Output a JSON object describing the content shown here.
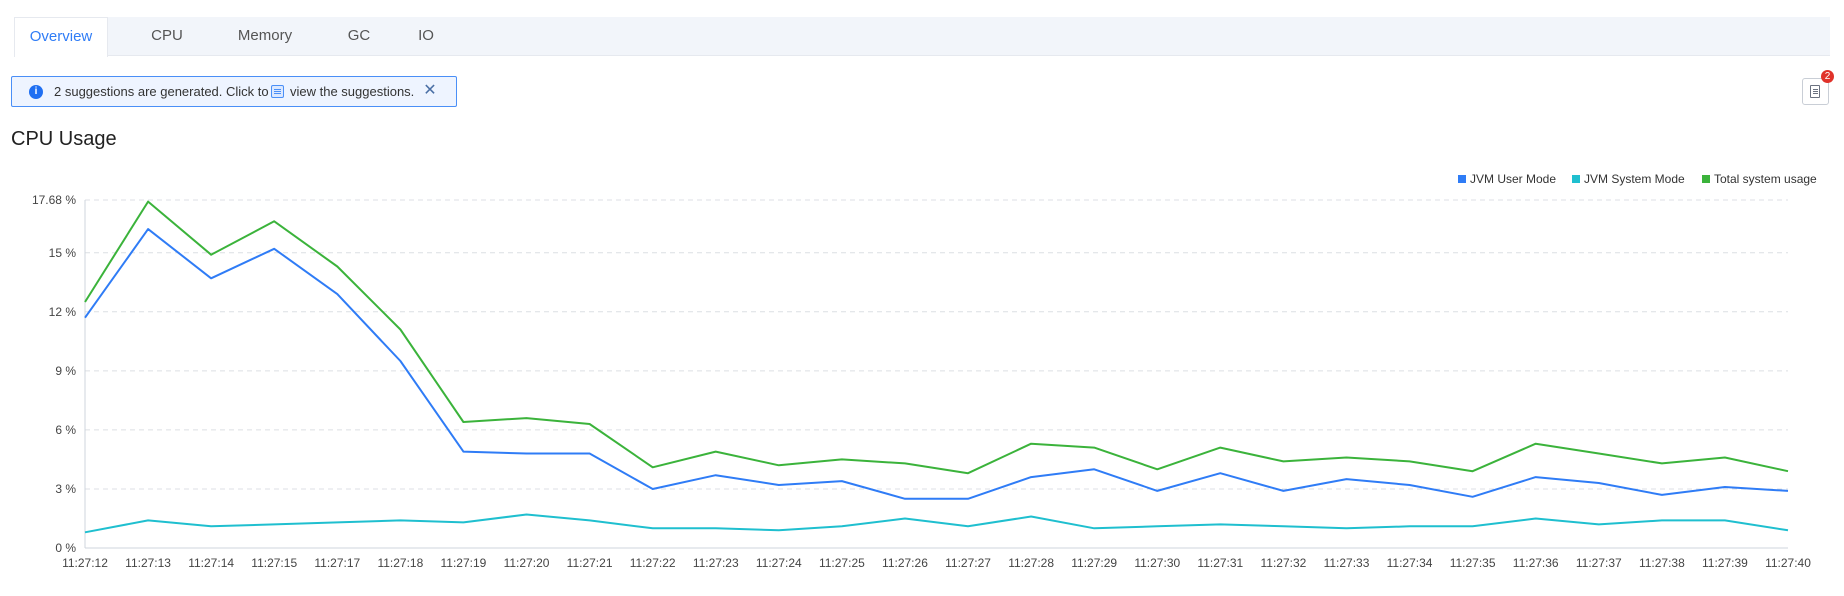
{
  "tabs": [
    {
      "label": "Overview",
      "active": true
    },
    {
      "label": "CPU",
      "active": false
    },
    {
      "label": "Memory",
      "active": false
    },
    {
      "label": "GC",
      "active": false
    },
    {
      "label": "IO",
      "active": false
    }
  ],
  "banner": {
    "icon": "info-icon",
    "text_before": "2 suggestions are generated. Click to",
    "text_after": "view the suggestions.",
    "close_icon": "close-icon"
  },
  "report_button": {
    "icon": "report-icon",
    "badge_count": "2"
  },
  "section": {
    "title": "CPU Usage"
  },
  "colors": {
    "accent": "#2f7cf6",
    "user": "#2f7cf6",
    "system": "#1fbfcf",
    "total": "#3bb33b",
    "badge": "#e0322a"
  },
  "chart_data": {
    "type": "line",
    "x": [
      "11:27:12",
      "11:27:13",
      "11:27:14",
      "11:27:15",
      "11:27:17",
      "11:27:18",
      "11:27:19",
      "11:27:20",
      "11:27:21",
      "11:27:22",
      "11:27:23",
      "11:27:24",
      "11:27:25",
      "11:27:26",
      "11:27:27",
      "11:27:28",
      "11:27:29",
      "11:27:30",
      "11:27:31",
      "11:27:32",
      "11:27:33",
      "11:27:34",
      "11:27:35",
      "11:27:36",
      "11:27:37",
      "11:27:38",
      "11:27:39",
      "11:27:40"
    ],
    "y_ticks": [
      "0 %",
      "3 %",
      "6 %",
      "9 %",
      "12 %",
      "15 %",
      "17.68 %"
    ],
    "y_tick_values": [
      0,
      3,
      6,
      9,
      12,
      15,
      17.68
    ],
    "ylim": [
      0,
      17.68
    ],
    "grid": true,
    "legend_position": "top-right",
    "series": [
      {
        "name": "JVM User Mode",
        "color": "#2f7cf6",
        "values": [
          11.7,
          16.2,
          13.7,
          15.2,
          12.9,
          9.5,
          4.9,
          4.8,
          4.8,
          3.0,
          3.7,
          3.2,
          3.4,
          2.5,
          2.5,
          3.6,
          4.0,
          2.9,
          3.8,
          2.9,
          3.5,
          3.2,
          2.6,
          3.6,
          3.3,
          2.7,
          3.1,
          2.9
        ]
      },
      {
        "name": "JVM System Mode",
        "color": "#1fbfcf",
        "values": [
          0.8,
          1.4,
          1.1,
          1.2,
          1.3,
          1.4,
          1.3,
          1.7,
          1.4,
          1.0,
          1.0,
          0.9,
          1.1,
          1.5,
          1.1,
          1.6,
          1.0,
          1.1,
          1.2,
          1.1,
          1.0,
          1.1,
          1.1,
          1.5,
          1.2,
          1.4,
          1.4,
          0.9
        ]
      },
      {
        "name": "Total system usage",
        "color": "#3bb33b",
        "values": [
          12.5,
          17.6,
          14.9,
          16.6,
          14.3,
          11.1,
          6.4,
          6.6,
          6.3,
          4.1,
          4.9,
          4.2,
          4.5,
          4.3,
          3.8,
          5.3,
          5.1,
          4.0,
          5.1,
          4.4,
          4.6,
          4.4,
          3.9,
          5.3,
          4.8,
          4.3,
          4.6,
          3.9
        ]
      }
    ]
  }
}
